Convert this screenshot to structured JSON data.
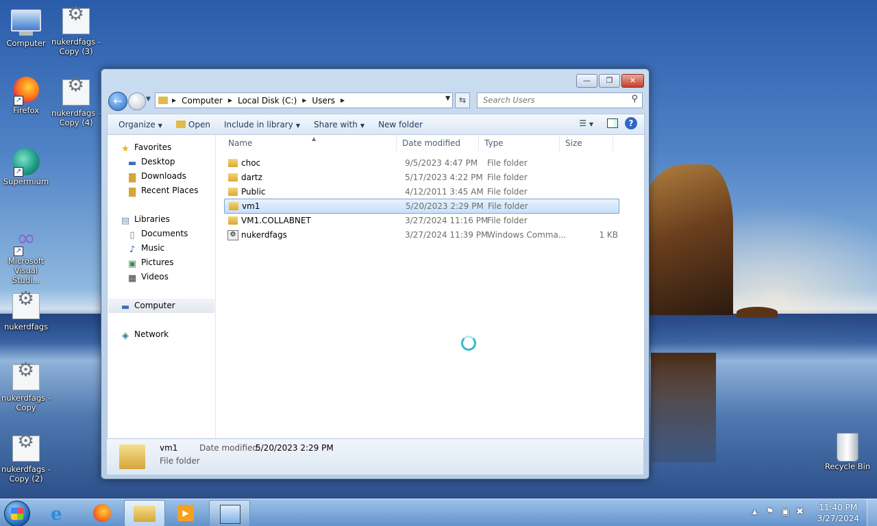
{
  "desktop": {
    "icons": [
      {
        "label": "Computer"
      },
      {
        "label": "nukerdfags - Copy (3)"
      },
      {
        "label": "Firefox"
      },
      {
        "label": "nukerdfags - Copy (4)"
      },
      {
        "label": "Supermium"
      },
      {
        "label": "Microsoft Visual Studi..."
      },
      {
        "label": "nukerdfags"
      },
      {
        "label": "nukerdfags - Copy"
      },
      {
        "label": "nukerdfags - Copy (2)"
      },
      {
        "label": "Recycle Bin"
      }
    ]
  },
  "window": {
    "caption": {
      "minimize": "—",
      "restore": "❐",
      "close": "✕"
    },
    "address": {
      "crumbs": [
        "Computer",
        "Local Disk (C:)",
        "Users"
      ]
    },
    "search": {
      "placeholder": "Search Users"
    },
    "toolbar": {
      "organize": "Organize",
      "open": "Open",
      "include": "Include in library",
      "share": "Share with",
      "new_folder": "New folder",
      "help": "?"
    },
    "nav": {
      "favorites": "Favorites",
      "desktop": "Desktop",
      "downloads": "Downloads",
      "recent": "Recent Places",
      "libraries": "Libraries",
      "documents": "Documents",
      "music": "Music",
      "pictures": "Pictures",
      "videos": "Videos",
      "computer": "Computer",
      "network": "Network"
    },
    "columns": {
      "name": "Name",
      "date": "Date modified",
      "type": "Type",
      "size": "Size"
    },
    "files": [
      {
        "name": "choc",
        "date": "9/5/2023 4:47 PM",
        "type": "File folder",
        "size": ""
      },
      {
        "name": "dartz",
        "date": "5/17/2023 4:22 PM",
        "type": "File folder",
        "size": ""
      },
      {
        "name": "Public",
        "date": "4/12/2011 3:45 AM",
        "type": "File folder",
        "size": ""
      },
      {
        "name": "vm1",
        "date": "5/20/2023 2:29 PM",
        "type": "File folder",
        "size": ""
      },
      {
        "name": "VM1.COLLABNET",
        "date": "3/27/2024 11:16 PM",
        "type": "File folder",
        "size": ""
      },
      {
        "name": "nukerdfags",
        "date": "3/27/2024 11:39 PM",
        "type": "Windows Comma...",
        "size": "1 KB"
      }
    ],
    "details": {
      "name": "vm1",
      "type": "File folder",
      "modified_label": "Date modified:",
      "modified_value": "5/20/2023 2:29 PM"
    }
  },
  "taskbar": {
    "time": "11:40 PM",
    "date": "3/27/2024"
  }
}
